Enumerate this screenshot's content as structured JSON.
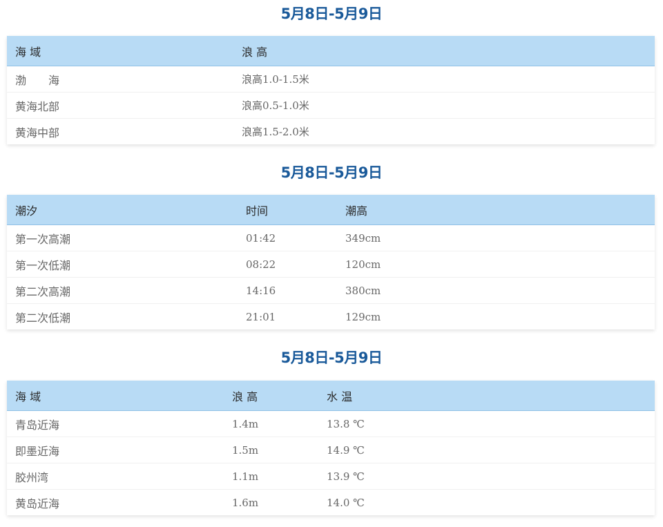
{
  "sections": [
    {
      "title": "5月8日-5月9日",
      "headers": [
        "海 域",
        "浪 高"
      ],
      "rows": [
        [
          "渤　　海",
          "浪高1.0-1.5米"
        ],
        [
          "黄海北部",
          "浪高0.5-1.0米"
        ],
        [
          "黄海中部",
          "浪高1.5-2.0米"
        ]
      ]
    },
    {
      "title": "5月8日-5月9日",
      "headers": [
        "潮汐",
        "时间",
        "潮高"
      ],
      "rows": [
        [
          "第一次高潮",
          "01:42",
          "349cm"
        ],
        [
          "第一次低潮",
          "08:22",
          "120cm"
        ],
        [
          "第二次高潮",
          "14:16",
          "380cm"
        ],
        [
          "第二次低潮",
          "21:01",
          "129cm"
        ]
      ]
    },
    {
      "title": "5月8日-5月9日",
      "headers": [
        "海 域",
        "浪 高",
        "水 温"
      ],
      "rows": [
        [
          "青岛近海",
          "1.4m",
          "13.8 ℃"
        ],
        [
          "即墨近海",
          "1.5m",
          "14.9 ℃"
        ],
        [
          "胶州湾",
          "1.1m",
          "13.9 ℃"
        ],
        [
          "黄岛近海",
          "1.6m",
          "14.0 ℃"
        ]
      ]
    }
  ]
}
